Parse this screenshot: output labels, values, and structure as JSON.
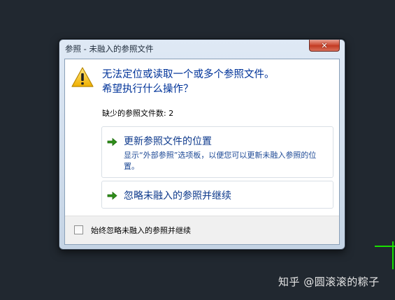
{
  "dialog": {
    "title": "参照 - 未融入的参照文件",
    "close_glyph": "✕",
    "main_instruction_line1": "无法定位或读取一个或多个参照文件。",
    "main_instruction_line2": "希望执行什么操作？",
    "missing_count_text": "缺少的参照文件数: 2",
    "commands": [
      {
        "title": "更新参照文件的位置",
        "description": "显示“外部参照”选项板，以便您可以更新未融入参照的位置。",
        "icon": "green-arrow-icon"
      },
      {
        "title": "忽略未融入的参照并继续",
        "icon": "green-arrow-icon"
      }
    ],
    "checkbox_label": "始终忽略未融入的参照并继续",
    "checkbox_checked": false
  },
  "watermark": "知乎 @圆滚滚的粽子",
  "colors": {
    "background": "#212830",
    "accent_blue": "#003399",
    "link_blue": "#0e3a8c",
    "arrow_green": "#2f8f1a",
    "cad_green_line": "#19e000"
  }
}
